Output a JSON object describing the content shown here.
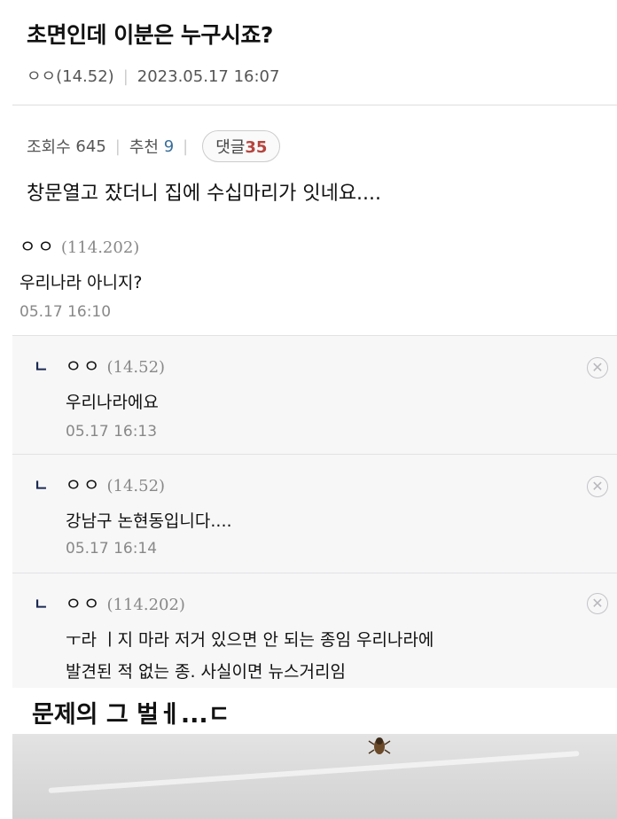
{
  "post": {
    "title": "초면인데 이분은 누구시죠?",
    "author": "ㅇㅇ(14.52)",
    "datetime": "2023.05.17 16:07",
    "views_label": "조회수",
    "views": "645",
    "recommend_label": "추천",
    "recommend": "9",
    "comments_label": "댓글",
    "comments": "35",
    "body": "창문열고 잤더니 집에 수십마리가 잇네요...."
  },
  "comments": [
    {
      "author": "ㅇㅇ",
      "ip": "(114.202)",
      "text": "우리나라 아니지?",
      "time": "05.17 16:10"
    }
  ],
  "replies": [
    {
      "mark": "ㄴ",
      "author": "ㅇㅇ",
      "ip": "(14.52)",
      "text": "우리나라에요",
      "time": "05.17 16:13"
    },
    {
      "mark": "ㄴ",
      "author": "ㅇㅇ",
      "ip": "(14.52)",
      "text": "강남구 논현동입니다....",
      "time": "05.17 16:14"
    },
    {
      "mark": "ㄴ",
      "author": "ㅇㅇ",
      "ip": "(114.202)",
      "text_line1": "ㅜ라 ㅣ지 마라 저거 있으면 안 되는 종임 우리나라에",
      "text_line2": "발견된 적 없는 종. 사실이면 뉴스거리임"
    }
  ],
  "caption": "문제의 그 벌ㅔ...ㄷ",
  "icons": {
    "delete": "circle-x-icon"
  }
}
